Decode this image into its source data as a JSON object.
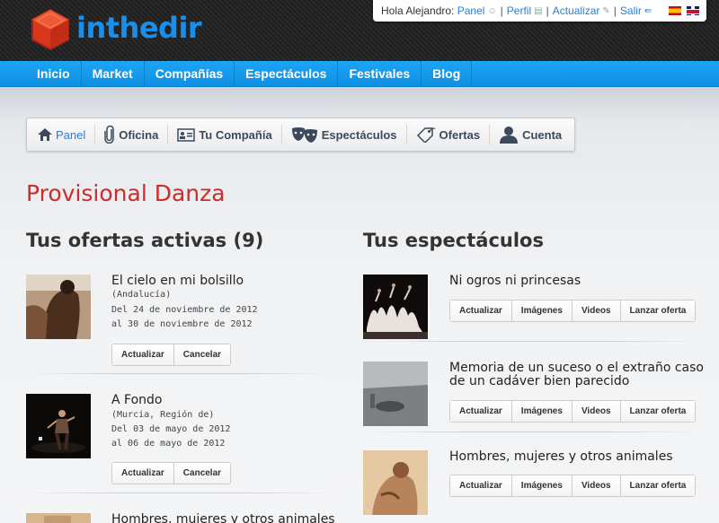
{
  "brand": {
    "logo_text": "inthedir"
  },
  "userbar": {
    "greeting": "Hola Alejandro:",
    "links": [
      "Panel",
      "Perfil",
      "Actualizar",
      "Salir"
    ],
    "separator": "|"
  },
  "nav": {
    "items": [
      "Inicio",
      "Market",
      "Compañías",
      "Espectáculos",
      "Festivales",
      "Blog"
    ]
  },
  "subnav": {
    "items": [
      "Panel",
      "Oficina",
      "Tu Compañía",
      "Espectáculos",
      "Ofertas",
      "Cuenta"
    ]
  },
  "page": {
    "title": "Provisional Danza"
  },
  "offers": {
    "heading": "Tus ofertas activas (9)",
    "buttons": [
      "Actualizar",
      "Cancelar"
    ],
    "items": [
      {
        "title": "El cielo en mi bolsillo",
        "region": "(Andalucía)",
        "from": "Del 24 de noviembre de 2012",
        "to": "al 30 de noviembre de 2012"
      },
      {
        "title": "A Fondo",
        "region": "(Murcia, Región de)",
        "from": "Del 03 de mayo de 2012",
        "to": "al 06 de mayo de 2012"
      },
      {
        "title": "Hombres, mujeres y otros animales"
      }
    ]
  },
  "shows": {
    "heading": "Tus espectáculos",
    "buttons": [
      "Actualizar",
      "Imágenes",
      "Videos",
      "Lanzar oferta"
    ],
    "items": [
      {
        "title": "Ni ogros ni princesas"
      },
      {
        "title_line1": "Memoria de un suceso o el extraño caso",
        "title_line2": "de un cadáver bien parecido"
      },
      {
        "title": "Hombres, mujeres y otros animales"
      }
    ]
  }
}
